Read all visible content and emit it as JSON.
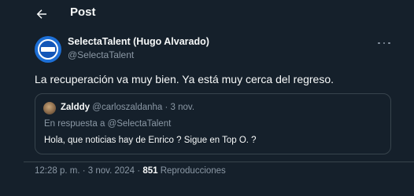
{
  "header": {
    "title": "Post"
  },
  "post": {
    "author_name": "SelectaTalent (Hugo Alvarado)",
    "author_handle": "@SelectaTalent",
    "text": "La recuperación va muy bien. Ya está muy cerca del regreso.",
    "time": "12:28 p. m.",
    "separator": "·",
    "date": "3 nov. 2024",
    "views_count": "851",
    "views_label": "Reproducciones"
  },
  "quote": {
    "author_name": "Zalddy",
    "author_handle": "@carloszaldanha",
    "separator": "·",
    "date": "3 nov.",
    "reply_prefix": "En respuesta a",
    "reply_handle": "@SelectaTalent",
    "text": "Hola, que noticias hay de Enrico ? Sigue en Top O. ?"
  },
  "icons": {
    "back": "arrow-left-icon",
    "more": "more-horizontal-icon"
  },
  "colors": {
    "background": "#15202b",
    "text_primary": "#f7f9f9",
    "text_secondary": "#8b98a5",
    "border": "#38444d",
    "avatar_blue": "#1d6fd6"
  }
}
